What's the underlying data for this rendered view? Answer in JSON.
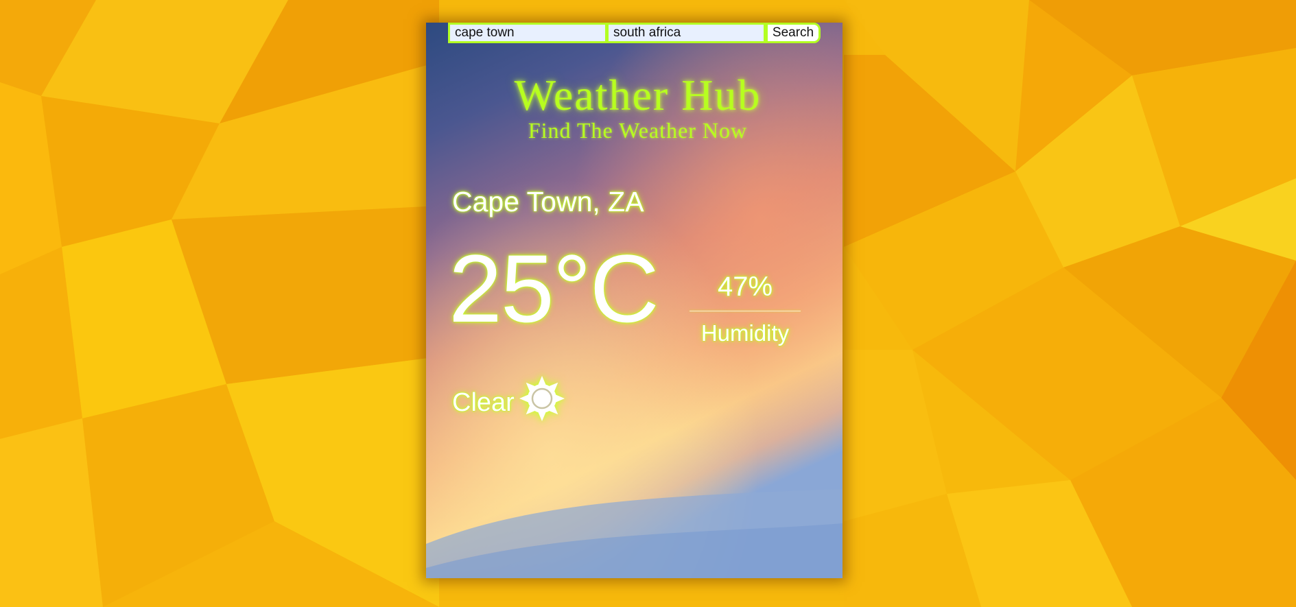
{
  "search": {
    "city_value": "cape town",
    "country_value": "south africa",
    "button_label": "Search"
  },
  "header": {
    "title": "Weather Hub",
    "subtitle": "Find The Weather Now"
  },
  "weather": {
    "location": "Cape Town, ZA",
    "temperature": "25°C",
    "humidity_value": "47%",
    "humidity_label": "Humidity",
    "condition": "Clear",
    "condition_icon": "sun-icon"
  },
  "colors": {
    "accent": "#b7ff1f",
    "background": "#f5b60a",
    "text": "#ffffff"
  }
}
